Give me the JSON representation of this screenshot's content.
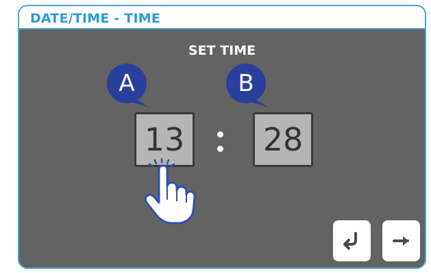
{
  "window": {
    "title": "DATE/TIME - TIME"
  },
  "screen": {
    "subtitle": "SET TIME"
  },
  "time": {
    "hour": "13",
    "minute": "28",
    "separator": ":"
  },
  "callouts": {
    "a": "A",
    "b": "B"
  },
  "colors": {
    "accent": "#2e9bd2",
    "border": "#4aa6d6",
    "panel": "#636363",
    "callout": "#2a3f9c",
    "field": "#b5b5b5"
  },
  "icons": {
    "back": "return-arrow-icon",
    "next": "right-arrow-icon",
    "touch": "tapping-hand-icon"
  }
}
